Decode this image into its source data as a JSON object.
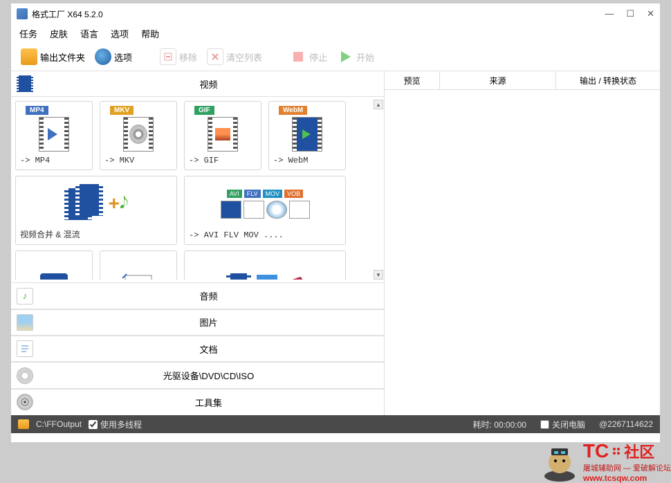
{
  "window": {
    "title": "格式工厂 X64 5.2.0"
  },
  "menu": {
    "task": "任务",
    "skin": "皮肤",
    "language": "语言",
    "option": "选项",
    "help": "帮助"
  },
  "toolbar": {
    "output_folder": "输出文件夹",
    "option": "选项",
    "remove": "移除",
    "clear": "清空列表",
    "stop": "停止",
    "start": "开始"
  },
  "sections": {
    "video": "视频",
    "audio": "音频",
    "picture": "图片",
    "document": "文档",
    "rom": "光驱设备\\DVD\\CD\\ISO",
    "toolset": "工具集"
  },
  "tiles": {
    "mp4": {
      "badge": "MP4",
      "label": "-> MP4"
    },
    "mkv": {
      "badge": "MKV",
      "label": "-> MKV"
    },
    "gif": {
      "badge": "GIF",
      "label": "-> GIF"
    },
    "webm": {
      "badge": "WebM",
      "label": "-> WebM"
    },
    "merge": {
      "label": "视频合并 & 混流"
    },
    "multi": {
      "badges": {
        "avi": "AVI",
        "flv": "FLV",
        "mov": "MOV",
        "vob": "VOB"
      },
      "label": "-> AVI FLV MOV ...."
    }
  },
  "right": {
    "preview": "预览",
    "source": "来源",
    "output": "输出 / 转换状态"
  },
  "status": {
    "path": "C:\\FFOutput",
    "multithread": "使用多线程",
    "elapsed_label": "耗时:",
    "elapsed_time": "00:00:00",
    "shutdown": "关闭电脑",
    "qq": "@2267114622"
  },
  "watermark": {
    "tc": "TC",
    "community": "社区",
    "sub1": "屠城辅助网",
    "sub2": "爱破解论坛",
    "url": "www.tcsqw.com"
  }
}
